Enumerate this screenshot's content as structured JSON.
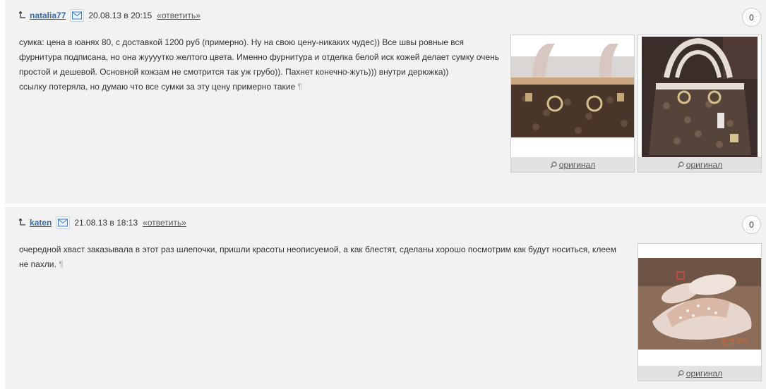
{
  "comments": [
    {
      "username": "natalia77",
      "date": "20.08.13 в 20:15",
      "reply_label": "«ответить»",
      "score": "0",
      "text_lines": [
        "сумка: цена в юанях 80, с доставкой 1200 руб (примерно). Ну на свою цену-никаких чудес)) Все швы ровные вся",
        "фурнитура подписана, но она жуууутко желтого цвета. Именно фурнитура и отделка белой иск кожей делает сумку очень",
        "простой и дешевой. Основной кожзам не смотрится так уж грубо)). Пахнет конечно-жуть))) внутри дерюжка))",
        "ссылку потеряла, но думаю что все сумки за эту цену примерно такие"
      ],
      "pilcrow": "¶",
      "images": [
        {
          "caption": "оригинал",
          "alt": "handbag-closeup"
        },
        {
          "caption": "оригинал",
          "alt": "handbag-full"
        }
      ]
    },
    {
      "username": "katen",
      "date": "21.08.13 в 18:13",
      "reply_label": "«ответить»",
      "score": "0",
      "text_lines": [
        "очередной хваст заказывала в этот раз шлепочки, пришли красоты неописуемой, а как блестят, сделаны хорошо посмотрим как будут носиться, клеем",
        "не пахли."
      ],
      "pilcrow": "¶",
      "images": [
        {
          "caption": "оригинал",
          "alt": "sandals-photo",
          "photo_stamp": "20.08.2013 13:57"
        }
      ]
    }
  ],
  "colors": {
    "username": "#3a6aa8",
    "panel_bg": "#f2f2f2",
    "caption_bg": "#e2e2e2"
  },
  "icons": [
    "reply-arrow-icon",
    "mail-icon",
    "magnifier-icon"
  ]
}
